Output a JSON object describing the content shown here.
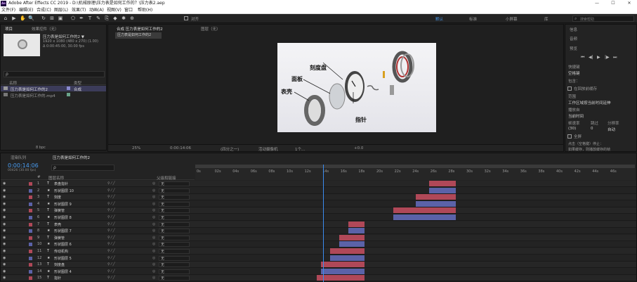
{
  "titlebar": {
    "logo": "Ae",
    "title": "Adobe After Effects CC 2019 - D:\\机械原理\\压力表是如何工作的？\\压力表2.aep",
    "minimize": "—",
    "maximize": "☐",
    "close": "✕"
  },
  "menubar": [
    "文件(F)",
    "编辑(E)",
    "合成(C)",
    "图层(L)",
    "效果(T)",
    "动画(A)",
    "视图(V)",
    "窗口",
    "帮助(H)"
  ],
  "toolbar": {
    "tools": [
      "⌂",
      "▶",
      "✋",
      "🔍",
      "↻",
      "⊞",
      "▣",
      "⬠",
      "✒",
      "T",
      "✎",
      "⎘",
      "◆",
      "✱",
      "⊕"
    ],
    "snap_label": "对齐",
    "workspaces": [
      "默认",
      "标准",
      "小屏幕",
      "库"
    ],
    "search_placeholder": "搜索帮助"
  },
  "project": {
    "tabs": [
      "项目",
      "效果控件（无）"
    ],
    "comp_name": "压力表是如何工作的2 ▼",
    "comp_info": [
      "1920 x 1080 (480 x 270) (1.00)",
      "Δ 0:00:45:00, 30.00 fps"
    ],
    "search_placeholder": "ρ",
    "columns": [
      "名称",
      "类型"
    ],
    "items": [
      {
        "name": "压力表是如何工作的2",
        "type": "合成"
      },
      {
        "name": "压力表是如何工作的.mp4",
        "type": ""
      }
    ],
    "footer": "8 bpc"
  },
  "composition": {
    "tab": "合成 压力表是如何工作的2",
    "subtab": "压力表是如何工作的2",
    "layer_tab": "图层（无）",
    "callouts": [
      "刻度盘",
      "面板",
      "表壳",
      "指针"
    ],
    "footer": {
      "zoom": "25%",
      "timecode": "0:00:14:06",
      "res": "(四分之一)",
      "camera": "活动摄像机",
      "views": "1个...",
      "exposure": "+0.0"
    }
  },
  "right": {
    "tabs": [
      "信息",
      "音频",
      "预览"
    ],
    "preview_controls": [
      "⏮",
      "◀|",
      "▶",
      "|▶",
      "⏭"
    ],
    "shortcut_label": "快捷键",
    "shortcut": "空格键",
    "include_label": "包含：",
    "cache_label": "在回放前缓存",
    "range_label": "范围",
    "range": "工作区域按当前时间延伸",
    "playfrom_label": "播放自",
    "playfrom": "当前时间",
    "fps_label": "帧速率",
    "skip_label": "跳过",
    "res_label": "分辨率",
    "fps": "(30)",
    "skip": "0",
    "res": "自动",
    "fullscreen_label": "全屏",
    "stop_label": "点击（空格键）停止：",
    "stop2": "如果缓存，则播放缓存的帧"
  },
  "timeline": {
    "tabs": [
      "渲染队列",
      "压力表是如何工作的2"
    ],
    "timecode": "0:00:14:06",
    "timecode_sub": "00426 (30.00 fps)",
    "search_placeholder": "ρ",
    "headers": [
      "#",
      "图层名称",
      "父级和链接"
    ],
    "ruler": [
      "0s",
      "02s",
      "04s",
      "06s",
      "08s",
      "10s",
      "12s",
      "14s",
      "16s",
      "18s",
      "20s",
      "22s",
      "24s",
      "26s",
      "28s",
      "30s",
      "32s",
      "34s",
      "36s",
      "38s",
      "40s",
      "42s",
      "44s",
      "46s"
    ],
    "parent_none": "无",
    "layers": [
      {
        "num": "1",
        "type": "T",
        "name": "表盘指针",
        "color": "#b04858",
        "bar_start": 26.0,
        "bar_end": 29.0
      },
      {
        "num": "2",
        "type": "★",
        "name": "形状图层 10",
        "color": "#5b62a8",
        "bar_start": 26.0,
        "bar_end": 29.0
      },
      {
        "num": "3",
        "type": "T",
        "name": "刻度",
        "color": "#b04858",
        "bar_start": 24.5,
        "bar_end": 29.0
      },
      {
        "num": "4",
        "type": "★",
        "name": "形状图层 9",
        "color": "#5b62a8",
        "bar_start": 24.5,
        "bar_end": 29.0
      },
      {
        "num": "5",
        "type": "T",
        "name": "弹簧管",
        "color": "#b04858",
        "bar_start": 22.0,
        "bar_end": 29.0
      },
      {
        "num": "6",
        "type": "★",
        "name": "形状图层 8",
        "color": "#5b62a8",
        "bar_start": 22.0,
        "bar_end": 29.0
      },
      {
        "num": "7",
        "type": "T",
        "name": "表壳",
        "color": "#b04858",
        "bar_start": 17.0,
        "bar_end": 18.8
      },
      {
        "num": "8",
        "type": "★",
        "name": "形状图层 7",
        "color": "#5b62a8",
        "bar_start": 17.0,
        "bar_end": 18.8
      },
      {
        "num": "9",
        "type": "T",
        "name": "弹簧管",
        "color": "#b04858",
        "bar_start": 16.0,
        "bar_end": 18.8
      },
      {
        "num": "10",
        "type": "★",
        "name": "形状图层 6",
        "color": "#5b62a8",
        "bar_start": 16.0,
        "bar_end": 18.8
      },
      {
        "num": "11",
        "type": "T",
        "name": "传动机构",
        "color": "#b04858",
        "bar_start": 15.0,
        "bar_end": 18.8
      },
      {
        "num": "12",
        "type": "★",
        "name": "形状图层 5",
        "color": "#5b62a8",
        "bar_start": 15.0,
        "bar_end": 18.8
      },
      {
        "num": "13",
        "type": "T",
        "name": "刻度盘",
        "color": "#b04858",
        "bar_start": 14.0,
        "bar_end": 18.8
      },
      {
        "num": "14",
        "type": "★",
        "name": "形状图层 4",
        "color": "#5b62a8",
        "bar_start": 14.0,
        "bar_end": 18.8
      },
      {
        "num": "15",
        "type": "T",
        "name": "指针",
        "color": "#b04858",
        "bar_start": 13.5,
        "bar_end": 18.8
      }
    ]
  }
}
